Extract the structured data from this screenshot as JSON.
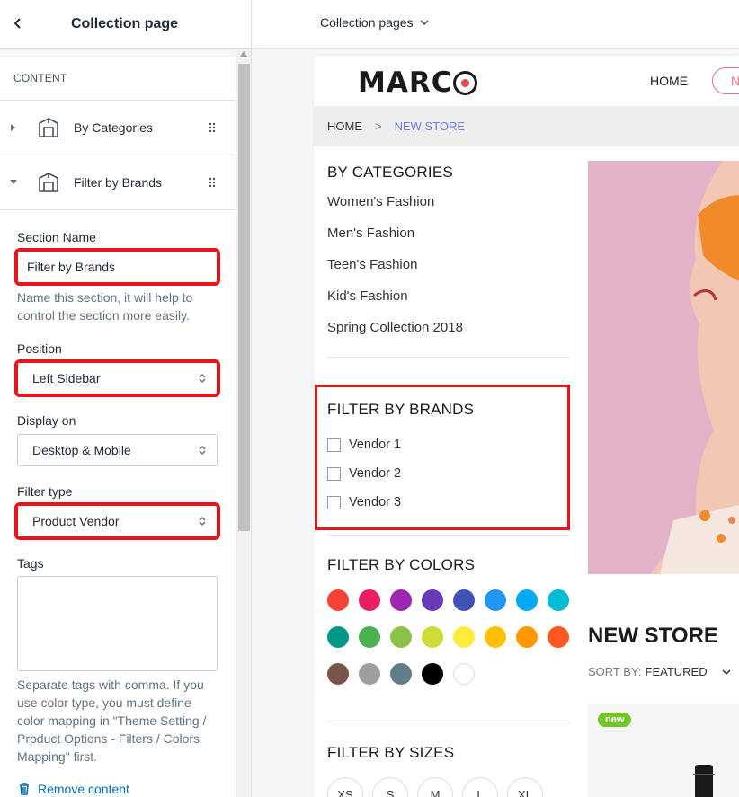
{
  "sidebar": {
    "title": "Collection page",
    "content_header": "CONTENT",
    "sections": [
      {
        "label": "By Categories",
        "expanded": false
      },
      {
        "label": "Filter by Brands",
        "expanded": true
      }
    ],
    "form": {
      "section_name_label": "Section Name",
      "section_name_value": "Filter by Brands",
      "section_name_help": "Name this section, it will help to control the section more easily.",
      "position_label": "Position",
      "position_value": "Left Sidebar",
      "display_label": "Display on",
      "display_value": "Desktop & Mobile",
      "filter_type_label": "Filter type",
      "filter_type_value": "Product Vendor",
      "tags_label": "Tags",
      "tags_value": "",
      "tags_help": "Separate tags with comma. If you use color type, you must define color mapping in \"Theme Setting / Product Options - Filters / Colors Mapping\" first.",
      "remove_label": "Remove content"
    }
  },
  "topbar": {
    "page_select": "Collection pages"
  },
  "store": {
    "logo": "MARCO",
    "logo_prefix": "MARC",
    "nav_home": "HOME",
    "nav_pill": "N",
    "breadcrumb_home": "HOME",
    "breadcrumb_sep": ">",
    "breadcrumb_current": "NEW STORE",
    "categories_title": "BY CATEGORIES",
    "categories": [
      "Women's Fashion",
      "Men's Fashion",
      "Teen's Fashion",
      "Kid's Fashion",
      "Spring Collection 2018"
    ],
    "brands_title": "FILTER BY BRANDS",
    "vendors": [
      "Vendor 1",
      "Vendor 2",
      "Vendor 3"
    ],
    "colors_title": "FILTER BY COLORS",
    "colors": [
      "#f44336",
      "#e91e63",
      "#9c27b0",
      "#673ab7",
      "#3f51b5",
      "#2196f3",
      "#03a9f4",
      "#00bcd4",
      "#009688",
      "#4caf50",
      "#8bc34a",
      "#cddc39",
      "#ffeb3b",
      "#ffc107",
      "#ff9800",
      "#ff5722",
      "#795548",
      "#9e9e9e",
      "#607d8b",
      "#000000",
      "#ffffff"
    ],
    "sizes_title": "FILTER BY SIZES",
    "sizes": [
      "XS",
      "S",
      "M",
      "L",
      "XL"
    ],
    "collection_title": "NEW STORE",
    "sort_label": "SORT BY:",
    "sort_value": "FEATURED",
    "product_badge": "new"
  }
}
